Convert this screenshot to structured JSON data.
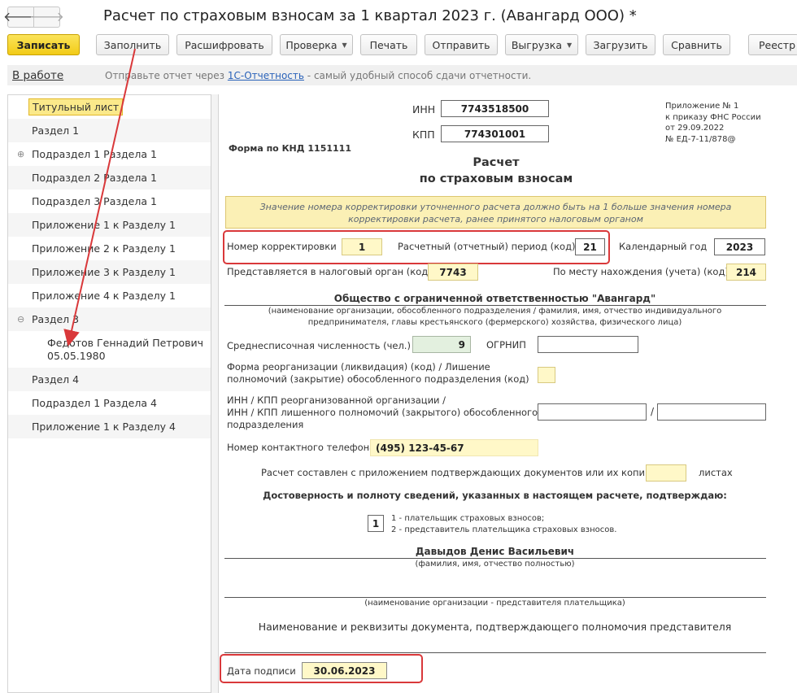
{
  "window": {
    "title": "Расчет по страховым взносам за 1 квартал 2023 г. (Авангард ООО) *",
    "back": "🡐",
    "forward": "🡒"
  },
  "toolbar": {
    "save": "Записать",
    "fill": "Заполнить",
    "decode": "Расшифровать",
    "check": "Проверка",
    "print": "Печать",
    "send": "Отправить",
    "export": "Выгрузка",
    "load": "Загрузить",
    "compare": "Сравнить",
    "registry": "Реестр"
  },
  "status": {
    "state": "В работе",
    "info_pre": "Отправьте отчет через",
    "info_link": "1С-Отчетность",
    "info_post": "- самый удобный способ сдачи отчетности."
  },
  "tree": [
    {
      "label": "Титульный лист"
    },
    {
      "label": "Раздел 1"
    },
    {
      "label": "Подраздел 1 Раздела 1"
    },
    {
      "label": "Подраздел 2 Раздела 1"
    },
    {
      "label": "Подраздел 3 Раздела 1"
    },
    {
      "label": "Приложение 1 к Разделу 1"
    },
    {
      "label": "Приложение 2 к Разделу 1"
    },
    {
      "label": "Приложение 3 к Разделу 1"
    },
    {
      "label": "Приложение 4 к Разделу 1"
    },
    {
      "label": "Раздел 3"
    },
    {
      "label": "Федотов Геннадий Петрович",
      "sub": "05.05.1980"
    },
    {
      "label": "Раздел 4"
    },
    {
      "label": "Подраздел 1 Раздела 4"
    },
    {
      "label": "Приложение 1 к Разделу 4"
    }
  ],
  "form": {
    "inn_label": "ИНН",
    "inn": "7743518500",
    "kpp_label": "КПП",
    "kpp": "774301001",
    "appendix": [
      "Приложение № 1",
      "к приказу ФНС России",
      "от 29.09.2022",
      "№ ЕД-7-11/878@"
    ],
    "knd": "Форма по КНД 1151111",
    "title1": "Расчет",
    "title2": "по страховым взносам",
    "note": "Значение номера корректировки уточненного расчета должно быть на 1 больше значения номера корректировки расчета, ранее принятого налоговым органом",
    "corr_label": "Номер корректировки",
    "corr": "1",
    "period_label": "Расчетный (отчетный) период (код)",
    "period": "21",
    "year_label": "Календарный год",
    "year": "2023",
    "tax_label": "Представляется в налоговый орган (код)",
    "tax": "7743",
    "place_label": "По месту нахождения (учета) (код)",
    "place": "214",
    "org": "Общество с ограниченной ответственностью \"Авангард\"",
    "org_hint1": "(наименование организации, обособленного подразделения / фамилия, имя, отчество индивидуального",
    "org_hint2": "предпринимателя, главы крестьянского (фермерского) хозяйства, физического лица)",
    "headcount_label": "Среднесписочная численность (чел.)",
    "headcount": "9",
    "ogrnip_label": "ОГРНИП",
    "reorg_label1": "Форма реорганизации (ликвидация) (код) / Лишение",
    "reorg_label2": "полномочий (закрытие) обособленного подразделения (код)",
    "inn_kpp_label1": "ИНН / КПП реорганизованной организации /",
    "inn_kpp_label2": "ИНН / КПП лишенного полномочий (закрытого) обособленного",
    "inn_kpp_label3": "подразделения",
    "slash": "/",
    "phone_label": "Номер контактного телефона",
    "phone": "(495) 123-45-67",
    "attach_label": "Расчет составлен с приложением подтверждающих документов или их копий на",
    "attach_suffix": "листах",
    "confirm": "Достоверность и полноту сведений, указанных в настоящем расчете, подтверждаю:",
    "signer_code": "1",
    "signer_opt1": "1 - плательщик страховых взносов;",
    "signer_opt2": "2 - представитель плательщика страховых взносов.",
    "person": "Давыдов Денис Васильевич",
    "person_hint": "(фамилия, имя, отчество полностью)",
    "rep_hint": "(наименование организации - представителя плательщика)",
    "doc_label": "Наименование и реквизиты документа, подтверждающего полномочия представителя",
    "date_label": "Дата подписи",
    "date": "30.06.2023"
  }
}
